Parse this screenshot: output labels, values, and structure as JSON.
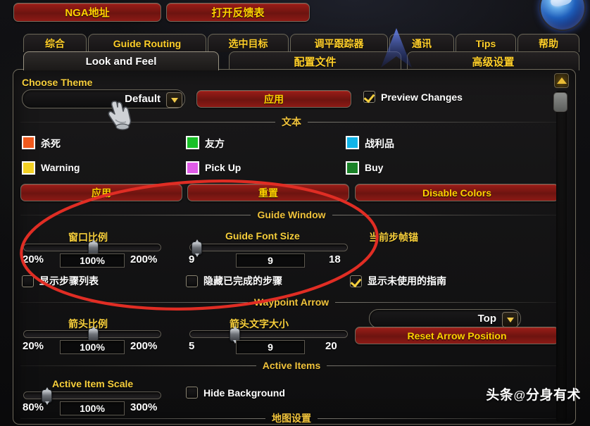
{
  "topbar": {
    "nga_button": "NGA地址",
    "feedback_button": "打开反馈表"
  },
  "tabs_row1": [
    {
      "label": "综合"
    },
    {
      "label": "Guide Routing"
    },
    {
      "label": "选中目标"
    },
    {
      "label": "调平跟踪器"
    },
    {
      "label": "通讯"
    },
    {
      "label": "Tips"
    },
    {
      "label": "帮助"
    }
  ],
  "tabs_row2": [
    {
      "label": "Look and Feel",
      "active": true
    },
    {
      "label": "配置文件",
      "active": false
    },
    {
      "label": "高级设置",
      "active": false
    }
  ],
  "theme": {
    "title": "Choose Theme",
    "selected": "Default",
    "apply_button": "应用",
    "preview_checkbox": "Preview Changes"
  },
  "text_section": {
    "title": "文本",
    "colors": [
      {
        "label": "杀死",
        "color": "#f05a1e"
      },
      {
        "label": "友方",
        "color": "#19c028"
      },
      {
        "label": "战利品",
        "color": "#10b4e8"
      },
      {
        "label": "Warning",
        "color": "#f2d024"
      },
      {
        "label": "Pick Up",
        "color": "#e05ce8"
      },
      {
        "label": "Buy",
        "color": "#1a8228"
      }
    ],
    "apply_button": "应用",
    "reset_button": "重置",
    "disable_colors_button": "Disable Colors"
  },
  "guide_window": {
    "title": "Guide Window",
    "window_scale": {
      "label": "窗口比例",
      "min": "20%",
      "max": "200%",
      "value": "100%",
      "percent": 0.5
    },
    "font_size": {
      "label": "Guide Font Size",
      "min": "9",
      "max": "18",
      "value": "9",
      "percent": 0.04
    },
    "anchor": {
      "label": "当前步帧锚",
      "selected": "Top"
    },
    "checkboxes": [
      {
        "label": "显示步骤列表",
        "checked": false
      },
      {
        "label": "隐藏已完成的步骤",
        "checked": false
      },
      {
        "label": "显示未使用的指南",
        "checked": true
      }
    ]
  },
  "waypoint_arrow": {
    "title": "Waypoint Arrow",
    "arrow_scale": {
      "label": "箭头比例",
      "min": "20%",
      "max": "200%",
      "value": "100%",
      "percent": 0.5
    },
    "arrow_font_size": {
      "label": "箭头文字大小",
      "min": "5",
      "max": "20",
      "value": "9",
      "percent": 0.28
    },
    "reset_button": "Reset Arrow Position"
  },
  "active_items": {
    "title": "Active Items",
    "scale": {
      "label": "Active Item Scale",
      "min": "80%",
      "max": "300%",
      "value": "100%",
      "percent": 0.16
    },
    "hide_background_checkbox": "Hide Background"
  },
  "bottom_section": {
    "title": "地图设置"
  },
  "watermark": {
    "brand": "头条",
    "at": "@",
    "user": "分身有术"
  },
  "icons": {
    "scroll_up": "scroll-up-icon",
    "dropdown_arrow": "chevron-down-icon",
    "cursor": "hand-cursor-icon",
    "portrait": "player-portrait-icon"
  },
  "accent": {
    "gold": "#f7cf3c",
    "red": "#8d1a15",
    "annotation": "#e02d24"
  }
}
